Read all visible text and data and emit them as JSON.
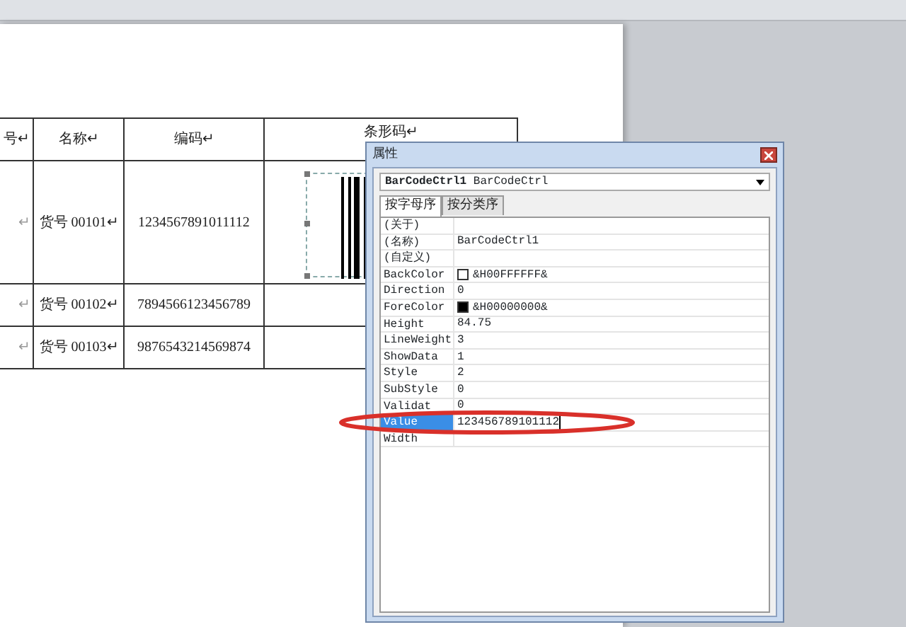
{
  "document": {
    "table": {
      "columns": [
        "号↵",
        "名称↵",
        "编码↵",
        "条形码↵"
      ],
      "rows": [
        {
          "column_1": "↵",
          "name": "货号 00101↵",
          "code": "1234567891011112",
          "has_barcode": true
        },
        {
          "column_1": "↵",
          "name": "货号 00102↵",
          "code": "7894566123456789",
          "has_barcode": false
        },
        {
          "column_1": "↵",
          "name": "货号 00103↵",
          "code": "9876543214569874",
          "has_barcode": false
        }
      ]
    }
  },
  "properties_window": {
    "title": "属性",
    "object_name": "BarCodeCtrl1",
    "object_type": "BarCodeCtrl",
    "tabs": [
      {
        "label": "按字母序",
        "selected": true
      },
      {
        "label": "按分类序",
        "selected": false
      }
    ],
    "properties": [
      {
        "name": "(关于)",
        "selected": false
      },
      {
        "name": "(名称)",
        "value": "BarCodeCtrl1",
        "selected": false
      },
      {
        "name": "(自定义)",
        "selected": false
      },
      {
        "name": "BackColor",
        "value": "&H00FFFFFF&",
        "color": "#ffffff",
        "selected": false
      },
      {
        "name": "Direction",
        "value": "0",
        "selected": false
      },
      {
        "name": "ForeColor",
        "value": "&H00000000&",
        "color": "#000000",
        "selected": false
      },
      {
        "name": "Height",
        "value": "84.75",
        "selected": false
      },
      {
        "name": "LineWeight",
        "value": "3",
        "selected": false
      },
      {
        "name": "ShowData",
        "value": "1",
        "selected": false
      },
      {
        "name": "Style",
        "value": "2",
        "selected": false
      },
      {
        "name": "SubStyle",
        "value": "0",
        "selected": false
      },
      {
        "name": "Validat",
        "value": "0",
        "selected": false
      },
      {
        "name": "Value",
        "value": "123456789101112",
        "selected": true
      },
      {
        "name": "Width",
        "selected": false
      }
    ]
  }
}
